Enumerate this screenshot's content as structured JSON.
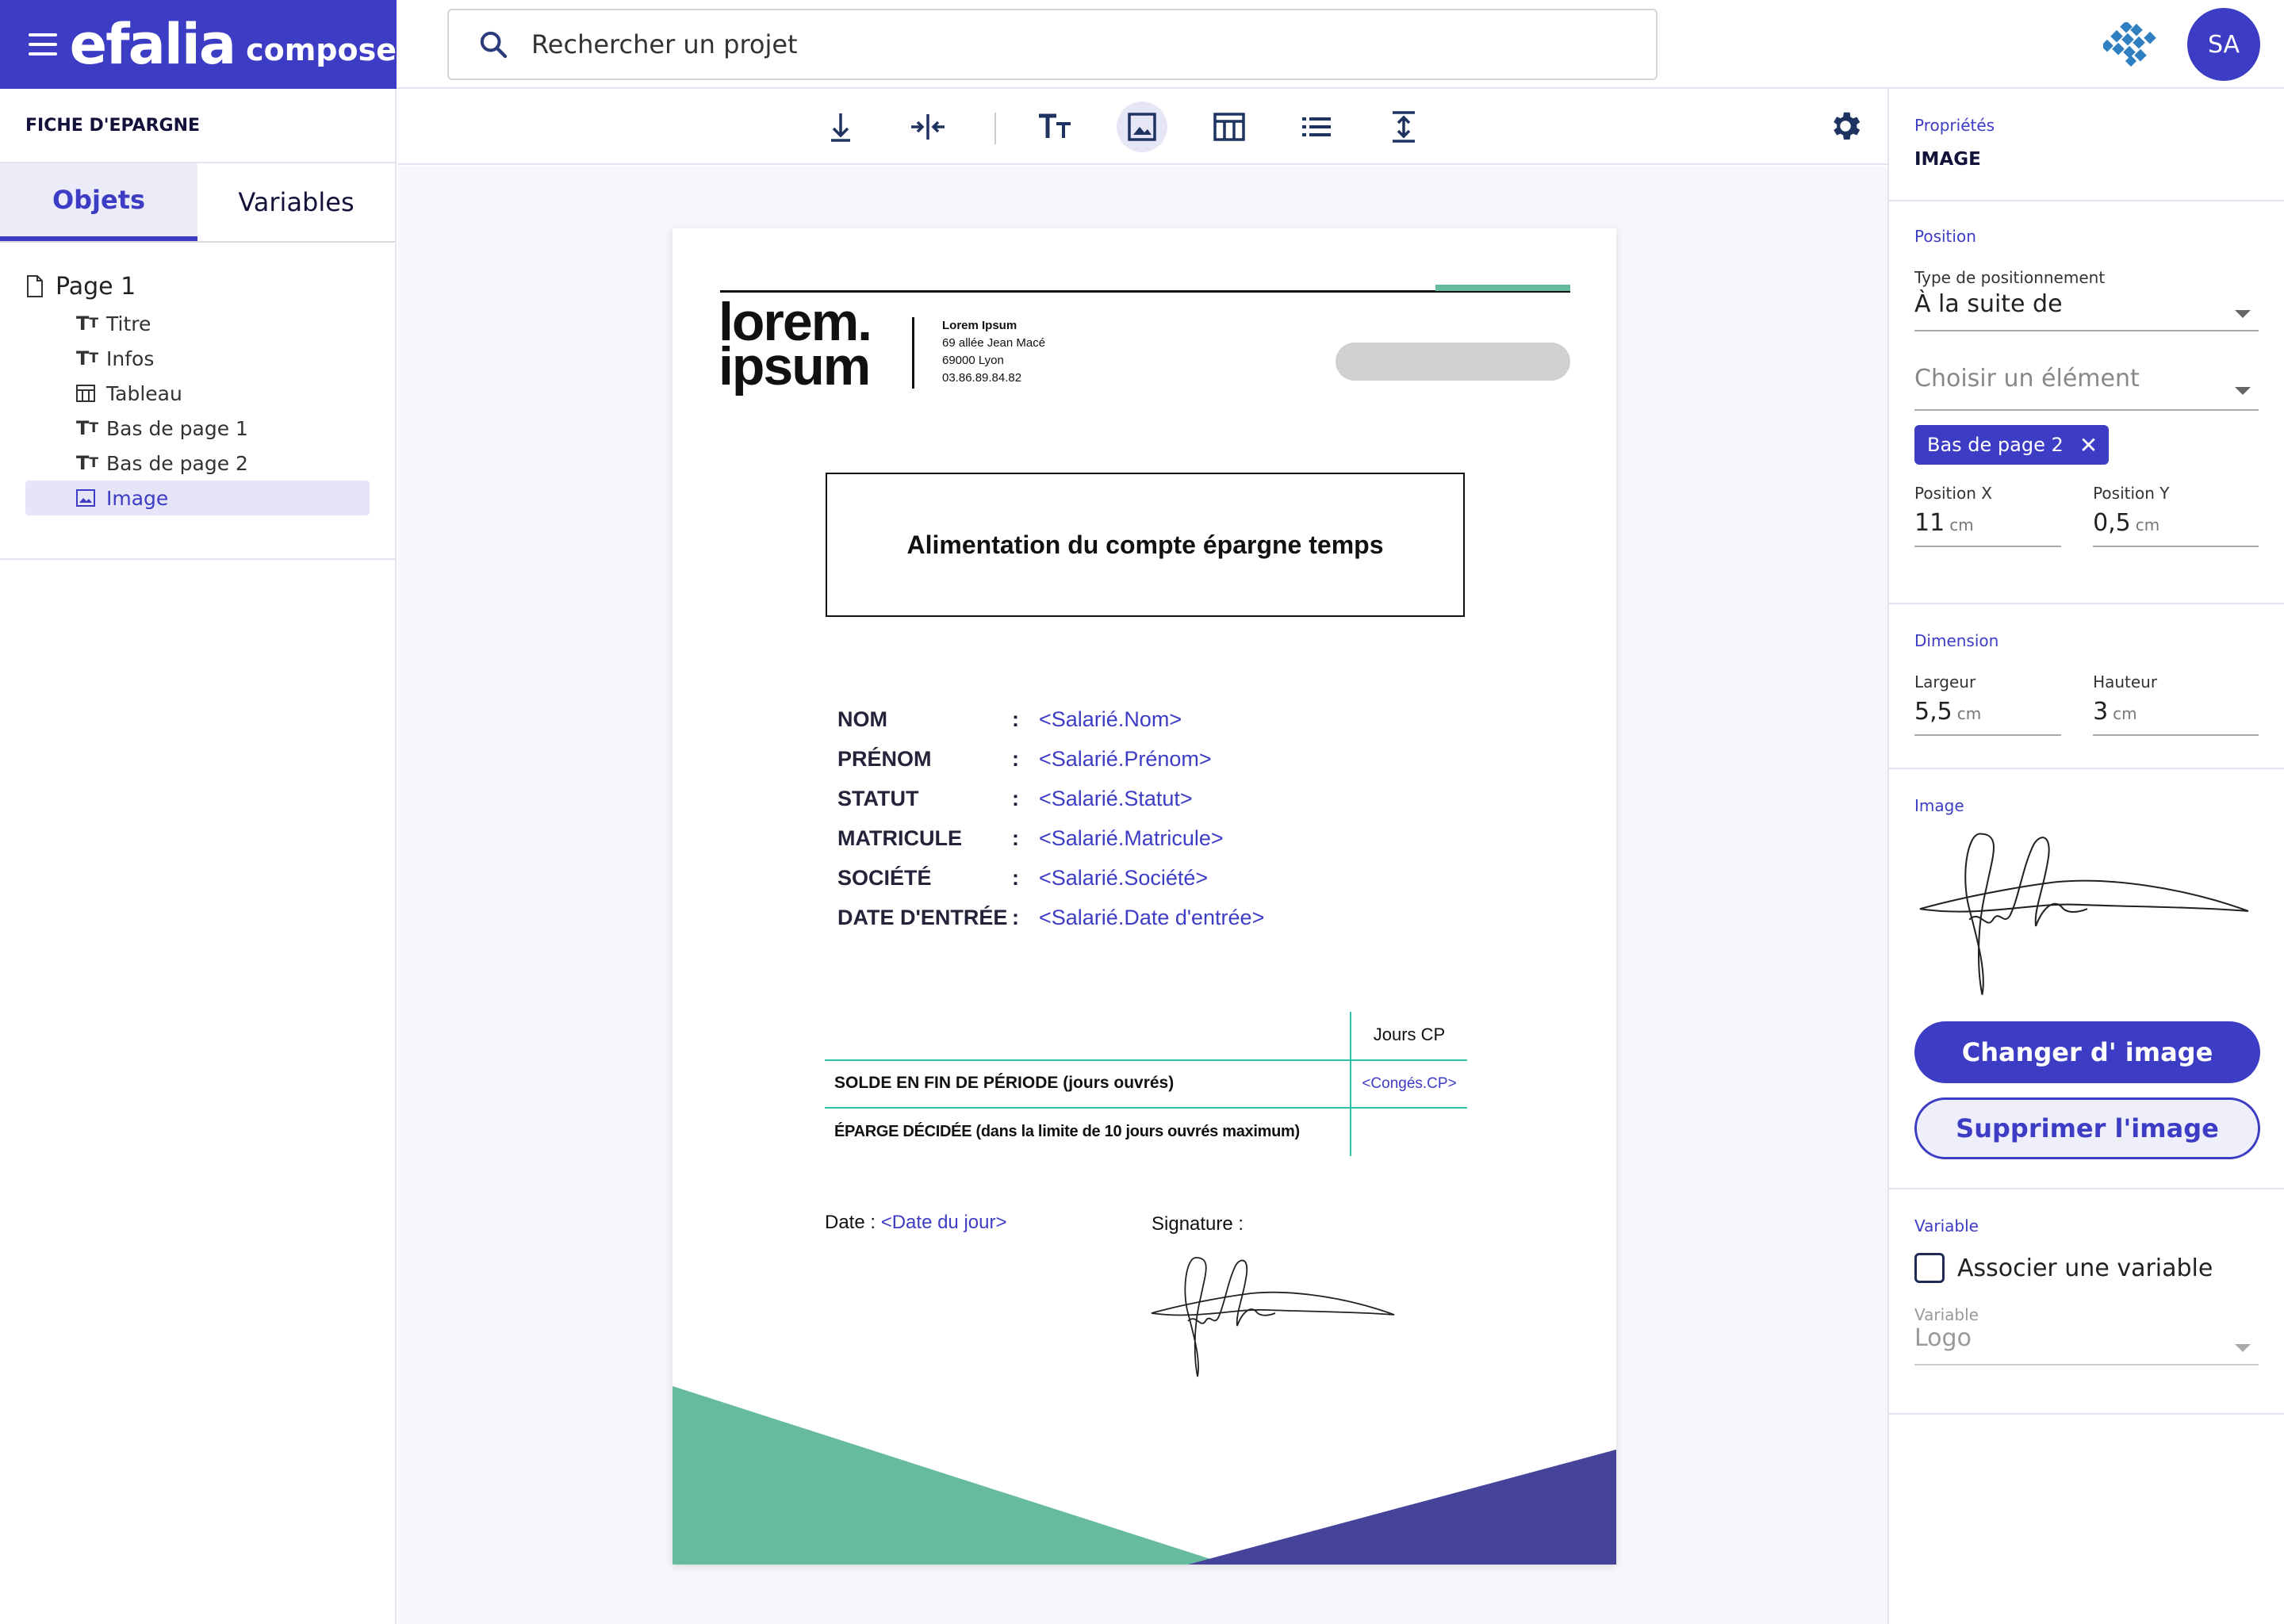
{
  "brand": {
    "name": "efalia",
    "product": "compose"
  },
  "search": {
    "placeholder": "Rechercher un projet"
  },
  "user": {
    "initials": "SA"
  },
  "left_panel": {
    "title": "FICHE D'EPARGNE",
    "tabs": [
      {
        "label": "Objets",
        "active": true
      },
      {
        "label": "Variables",
        "active": false
      }
    ],
    "page_label": "Page 1",
    "items": [
      {
        "label": "Titre",
        "icon": "text-icon"
      },
      {
        "label": "Infos",
        "icon": "text-icon"
      },
      {
        "label": "Tableau",
        "icon": "table-icon"
      },
      {
        "label": "Bas de page 1",
        "icon": "text-icon"
      },
      {
        "label": "Bas de page 2",
        "icon": "text-icon"
      },
      {
        "label": "Image",
        "icon": "image-icon",
        "selected": true
      }
    ]
  },
  "toolbar": {
    "tools": [
      "insert-below-icon",
      "split-columns-icon",
      "text-icon",
      "image-icon",
      "table-icon",
      "list-icon",
      "vertical-space-icon"
    ],
    "active_tool": "image-icon"
  },
  "document": {
    "logo_line1": "lorem.",
    "logo_line2": "ipsum",
    "company_name": "Lorem Ipsum",
    "company_address1": "69 allée Jean Macé",
    "company_address2": "69000 Lyon",
    "company_phone": "03.86.89.84.82",
    "title": "Alimentation du compte épargne temps",
    "fields": [
      {
        "label": "NOM",
        "sep": ":",
        "value": "<Salarié.Nom>"
      },
      {
        "label": "PRÉNOM",
        "sep": ":",
        "value": "<Salarié.Prénom>"
      },
      {
        "label": "STATUT",
        "sep": ":",
        "value": "<Salarié.Statut>"
      },
      {
        "label": "MATRICULE",
        "sep": ":",
        "value": "<Salarié.Matricule>"
      },
      {
        "label": "SOCIÉTÉ",
        "sep": ":",
        "value": "<Salarié.Société>"
      },
      {
        "label": "DATE D'ENTRÉE",
        "sep": ":",
        "value": "<Salarié.Date d'entrée>"
      }
    ],
    "table": {
      "header": "Jours CP",
      "rows": [
        {
          "label": "SOLDE EN FIN DE PÉRIODE (jours ouvrés)",
          "value": "<Congés.CP>"
        },
        {
          "label": "ÉPARGE DÉCIDÉE (dans la limite de 10 jours ouvrés maximum)",
          "value": ""
        }
      ]
    },
    "date_label": "Date :",
    "date_value": "<Date du jour>",
    "signature_label": "Signature :",
    "colors": {
      "teal": "#66bb9f",
      "purple": "#45449a",
      "accent": "#3d3cc4"
    }
  },
  "properties": {
    "header": "Propriétés",
    "element_type": "IMAGE",
    "position": {
      "section": "Position",
      "type_label": "Type de positionnement",
      "type_value": "À la suite de",
      "element_placeholder": "Choisir un élément",
      "chip": "Bas de page 2",
      "x_label": "Position X",
      "x_value": "11",
      "x_unit": "cm",
      "y_label": "Position Y",
      "y_value": "0,5",
      "y_unit": "cm"
    },
    "dimension": {
      "section": "Dimension",
      "w_label": "Largeur",
      "w_value": "5,5",
      "w_unit": "cm",
      "h_label": "Hauteur",
      "h_value": "3",
      "h_unit": "cm"
    },
    "image": {
      "section": "Image",
      "change_label": "Changer d' image",
      "delete_label": "Supprimer l'image"
    },
    "variable": {
      "section": "Variable",
      "checkbox_label": "Associer une variable",
      "checked": false,
      "field_label": "Variable",
      "field_value": "Logo"
    }
  }
}
